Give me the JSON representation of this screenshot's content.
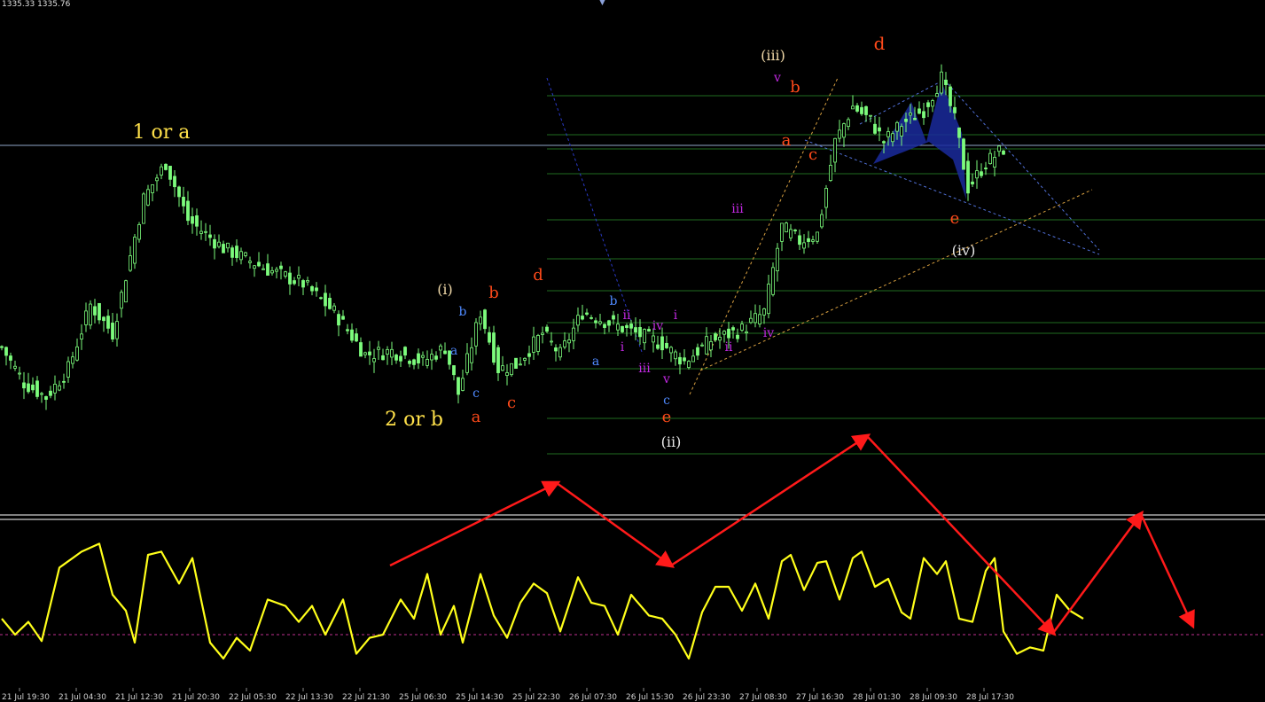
{
  "header": {
    "ohlc_text": "1335.33 1335.76"
  },
  "colors": {
    "background": "#000000",
    "candle": "#7CFC7C",
    "level_line": "#1f6b1f",
    "oscillator": "#FFFF1A",
    "projection": "#FF1A1A",
    "fib_fan": "#2a39c8",
    "wedge_fill": "#1a2a9c",
    "separator": "#ffffff"
  },
  "icons": {
    "top_marker": "triangle-down-icon"
  },
  "chart_data": {
    "type": "candlestick",
    "x_ticks": [
      "21 Jul 19:30",
      "21 Jul 04:30",
      "21 Jul 12:30",
      "21 Jul 20:30",
      "22 Jul 05:30",
      "22 Jul 13:30",
      "22 Jul 21:30",
      "25 Jul 06:30",
      "25 Jul 14:30",
      "25 Jul 22:30",
      "26 Jul 07:30",
      "26 Jul 15:30",
      "26 Jul 23:30",
      "27 Jul 08:30",
      "27 Jul 16:30",
      "28 Jul 01:30",
      "28 Jul 09:30",
      "28 Jul 17:30"
    ],
    "price_path": [
      {
        "i": 0,
        "v": 1331.0
      },
      {
        "i": 5,
        "v": 1326.0
      },
      {
        "i": 10,
        "v": 1324.0
      },
      {
        "i": 15,
        "v": 1328.0
      },
      {
        "i": 20,
        "v": 1337.0
      },
      {
        "i": 25,
        "v": 1333.0
      },
      {
        "i": 32,
        "v": 1352.0
      },
      {
        "i": 37,
        "v": 1357.0
      },
      {
        "i": 42,
        "v": 1349.0
      },
      {
        "i": 50,
        "v": 1345.0
      },
      {
        "i": 60,
        "v": 1342.0
      },
      {
        "i": 68,
        "v": 1340.0
      },
      {
        "i": 75,
        "v": 1336.0
      },
      {
        "i": 82,
        "v": 1330.0
      },
      {
        "i": 88,
        "v": 1330.5
      },
      {
        "i": 95,
        "v": 1329.0
      },
      {
        "i": 100,
        "v": 1331.0
      },
      {
        "i": 103,
        "v": 1324.5
      },
      {
        "i": 108,
        "v": 1336.0
      },
      {
        "i": 112,
        "v": 1328.0
      },
      {
        "i": 116,
        "v": 1328.5
      },
      {
        "i": 122,
        "v": 1333.0
      },
      {
        "i": 126,
        "v": 1330.0
      },
      {
        "i": 131,
        "v": 1336.0
      },
      {
        "i": 137,
        "v": 1334.5
      },
      {
        "i": 143,
        "v": 1333.0
      },
      {
        "i": 149,
        "v": 1331.5
      },
      {
        "i": 154,
        "v": 1329.0
      },
      {
        "i": 160,
        "v": 1332.0
      },
      {
        "i": 167,
        "v": 1333.5
      },
      {
        "i": 172,
        "v": 1336.0
      },
      {
        "i": 176,
        "v": 1348.0
      },
      {
        "i": 180,
        "v": 1346.0
      },
      {
        "i": 184,
        "v": 1347.0
      },
      {
        "i": 188,
        "v": 1360.0
      },
      {
        "i": 192,
        "v": 1365.0
      },
      {
        "i": 196,
        "v": 1363.0
      },
      {
        "i": 199,
        "v": 1360.0
      },
      {
        "i": 203,
        "v": 1362.5
      },
      {
        "i": 208,
        "v": 1364.5
      },
      {
        "i": 212,
        "v": 1369.0
      },
      {
        "i": 215,
        "v": 1363.0
      },
      {
        "i": 218,
        "v": 1353.5
      },
      {
        "i": 222,
        "v": 1357.0
      },
      {
        "i": 226,
        "v": 1359.0
      }
    ],
    "oscillator_path": [
      {
        "i": 0,
        "v": 40
      },
      {
        "i": 3,
        "v": 30
      },
      {
        "i": 6,
        "v": 38
      },
      {
        "i": 9,
        "v": 26
      },
      {
        "i": 13,
        "v": 72
      },
      {
        "i": 18,
        "v": 82
      },
      {
        "i": 22,
        "v": 87
      },
      {
        "i": 25,
        "v": 55
      },
      {
        "i": 28,
        "v": 45
      },
      {
        "i": 30,
        "v": 25
      },
      {
        "i": 33,
        "v": 80
      },
      {
        "i": 36,
        "v": 82
      },
      {
        "i": 40,
        "v": 62
      },
      {
        "i": 43,
        "v": 78
      },
      {
        "i": 47,
        "v": 25
      },
      {
        "i": 50,
        "v": 15
      },
      {
        "i": 53,
        "v": 28
      },
      {
        "i": 56,
        "v": 20
      },
      {
        "i": 60,
        "v": 52
      },
      {
        "i": 64,
        "v": 48
      },
      {
        "i": 67,
        "v": 38
      },
      {
        "i": 70,
        "v": 48
      },
      {
        "i": 73,
        "v": 30
      },
      {
        "i": 77,
        "v": 52
      },
      {
        "i": 80,
        "v": 18
      },
      {
        "i": 83,
        "v": 28
      },
      {
        "i": 86,
        "v": 30
      },
      {
        "i": 90,
        "v": 52
      },
      {
        "i": 93,
        "v": 40
      },
      {
        "i": 96,
        "v": 68
      },
      {
        "i": 99,
        "v": 30
      },
      {
        "i": 102,
        "v": 48
      },
      {
        "i": 104,
        "v": 25
      },
      {
        "i": 108,
        "v": 68
      },
      {
        "i": 111,
        "v": 42
      },
      {
        "i": 114,
        "v": 28
      },
      {
        "i": 117,
        "v": 50
      },
      {
        "i": 120,
        "v": 62
      },
      {
        "i": 123,
        "v": 56
      },
      {
        "i": 126,
        "v": 32
      },
      {
        "i": 130,
        "v": 66
      },
      {
        "i": 133,
        "v": 50
      },
      {
        "i": 136,
        "v": 48
      },
      {
        "i": 139,
        "v": 30
      },
      {
        "i": 142,
        "v": 55
      },
      {
        "i": 146,
        "v": 42
      },
      {
        "i": 149,
        "v": 40
      },
      {
        "i": 152,
        "v": 30
      },
      {
        "i": 155,
        "v": 15
      },
      {
        "i": 158,
        "v": 44
      },
      {
        "i": 161,
        "v": 60
      },
      {
        "i": 164,
        "v": 60
      },
      {
        "i": 167,
        "v": 45
      },
      {
        "i": 170,
        "v": 62
      },
      {
        "i": 173,
        "v": 40
      },
      {
        "i": 176,
        "v": 76
      },
      {
        "i": 178,
        "v": 80
      },
      {
        "i": 181,
        "v": 58
      },
      {
        "i": 184,
        "v": 75
      },
      {
        "i": 186,
        "v": 76
      },
      {
        "i": 189,
        "v": 52
      },
      {
        "i": 192,
        "v": 78
      },
      {
        "i": 194,
        "v": 82
      },
      {
        "i": 197,
        "v": 60
      },
      {
        "i": 200,
        "v": 65
      },
      {
        "i": 203,
        "v": 44
      },
      {
        "i": 205,
        "v": 40
      },
      {
        "i": 208,
        "v": 78
      },
      {
        "i": 211,
        "v": 68
      },
      {
        "i": 213,
        "v": 76
      },
      {
        "i": 216,
        "v": 40
      },
      {
        "i": 219,
        "v": 38
      },
      {
        "i": 222,
        "v": 70
      },
      {
        "i": 224,
        "v": 78
      },
      {
        "i": 226,
        "v": 32
      },
      {
        "i": 229,
        "v": 18
      },
      {
        "i": 232,
        "v": 22
      },
      {
        "i": 235,
        "v": 20
      },
      {
        "i": 238,
        "v": 55
      },
      {
        "i": 241,
        "v": 45
      },
      {
        "i": 244,
        "v": 40
      }
    ],
    "levels": [
      1366.5,
      1361.0,
      1359.0,
      1355.5,
      1349.0,
      1343.5,
      1339.0,
      1334.5,
      1333.0,
      1328.0,
      1321.0,
      1316.0
    ],
    "current_price": 1359.5,
    "oscillator_midline": 30,
    "wave_labels": [
      {
        "text": "1 or a",
        "i": 36,
        "v": 1360.5,
        "color": "#FFE14A",
        "size": 22
      },
      {
        "text": "2 or b",
        "i": 93,
        "v": 1320.0,
        "color": "#FFE14A",
        "size": 22
      },
      {
        "text": "(i)",
        "i": 100,
        "v": 1338.5,
        "color": "#F0D9A8",
        "size": 16
      },
      {
        "text": "b",
        "i": 104,
        "v": 1335.5,
        "color": "#4F8AFF",
        "size": 14
      },
      {
        "text": "a",
        "i": 102,
        "v": 1330.0,
        "color": "#4F8AFF",
        "size": 14
      },
      {
        "text": "c",
        "i": 107,
        "v": 1324.0,
        "color": "#4F8AFF",
        "size": 14
      },
      {
        "text": "a",
        "i": 107,
        "v": 1320.5,
        "color": "#FF4A1A",
        "size": 18
      },
      {
        "text": "b",
        "i": 111,
        "v": 1338.0,
        "color": "#FF4A1A",
        "size": 18
      },
      {
        "text": "c",
        "i": 115,
        "v": 1322.5,
        "color": "#FF4A1A",
        "size": 18
      },
      {
        "text": "d",
        "i": 121,
        "v": 1340.5,
        "color": "#FF4A1A",
        "size": 18
      },
      {
        "text": "a",
        "i": 134,
        "v": 1328.5,
        "color": "#4F8AFF",
        "size": 14
      },
      {
        "text": "b",
        "i": 138,
        "v": 1337.0,
        "color": "#4F8AFF",
        "size": 14
      },
      {
        "text": "ii",
        "i": 141,
        "v": 1335.0,
        "color": "#C028E0",
        "size": 14
      },
      {
        "text": "i",
        "i": 140,
        "v": 1330.5,
        "color": "#C028E0",
        "size": 14
      },
      {
        "text": "iv",
        "i": 148,
        "v": 1333.5,
        "color": "#C028E0",
        "size": 14
      },
      {
        "text": "i",
        "i": 152,
        "v": 1335.0,
        "color": "#C028E0",
        "size": 14
      },
      {
        "text": "iii",
        "i": 145,
        "v": 1327.5,
        "color": "#C028E0",
        "size": 14
      },
      {
        "text": "v",
        "i": 150,
        "v": 1326.0,
        "color": "#C028E0",
        "size": 14
      },
      {
        "text": "c",
        "i": 150,
        "v": 1323.0,
        "color": "#4F8AFF",
        "size": 14
      },
      {
        "text": "e",
        "i": 150,
        "v": 1320.5,
        "color": "#FF4A1A",
        "size": 18
      },
      {
        "text": "(ii)",
        "i": 151,
        "v": 1317.0,
        "color": "#E8E8E8",
        "size": 16
      },
      {
        "text": "ii",
        "i": 164,
        "v": 1330.5,
        "color": "#C028E0",
        "size": 14
      },
      {
        "text": "iii",
        "i": 166,
        "v": 1350.0,
        "color": "#C028E0",
        "size": 14
      },
      {
        "text": "iv",
        "i": 173,
        "v": 1332.5,
        "color": "#C028E0",
        "size": 14
      },
      {
        "text": "(iii)",
        "i": 174,
        "v": 1371.5,
        "color": "#F0D9A8",
        "size": 16
      },
      {
        "text": "v",
        "i": 175,
        "v": 1368.5,
        "color": "#C028E0",
        "size": 14
      },
      {
        "text": "b",
        "i": 179,
        "v": 1367.0,
        "color": "#FF4A1A",
        "size": 18
      },
      {
        "text": "a",
        "i": 177,
        "v": 1359.5,
        "color": "#FF4A1A",
        "size": 18
      },
      {
        "text": "c",
        "i": 183,
        "v": 1357.5,
        "color": "#FF4A1A",
        "size": 18
      },
      {
        "text": "d",
        "i": 198,
        "v": 1373.0,
        "color": "#FF4A1A",
        "size": 20
      },
      {
        "text": "e",
        "i": 215,
        "v": 1348.5,
        "color": "#FF4A1A",
        "size": 18
      },
      {
        "text": "(iv)",
        "i": 217,
        "v": 1344.0,
        "color": "#E8E8E8",
        "size": 16
      }
    ]
  }
}
